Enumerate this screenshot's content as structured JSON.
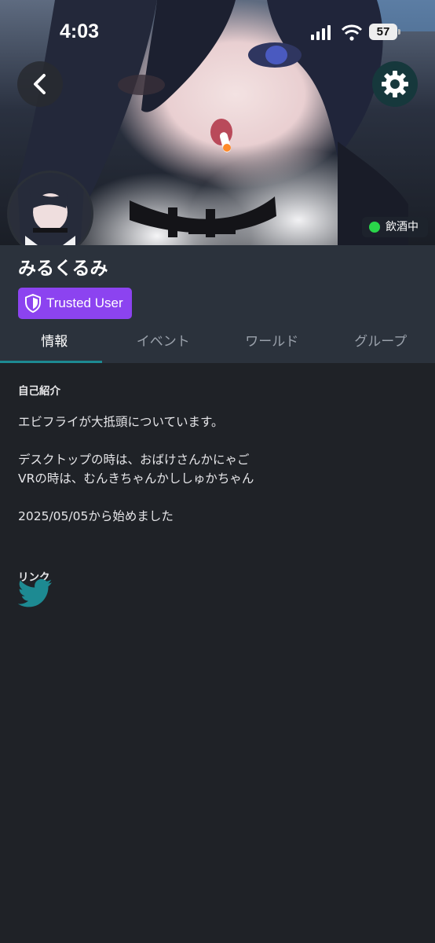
{
  "status_bar": {
    "time": "4:03",
    "battery": "57"
  },
  "header": {
    "back_icon": "chevron-left-icon",
    "settings_icon": "gear-icon",
    "status_text": "飲酒中",
    "status_color": "#2ad54a"
  },
  "profile": {
    "display_name": "みるくるみ",
    "trust_rank": "Trusted User",
    "trust_color": "#8c43f0"
  },
  "tabs": [
    {
      "label": "情報",
      "active": true
    },
    {
      "label": "イベント",
      "active": false
    },
    {
      "label": "ワールド",
      "active": false
    },
    {
      "label": "グループ",
      "active": false
    }
  ],
  "bio": {
    "title": "自己紹介",
    "lines": [
      "エビフライが大抵頭についています。",
      "",
      "デスクトップの時は、おばけさんかにゃご",
      "VRの時は、むんきちゃんかししゅかちゃん",
      "",
      "2025/05/05から始めました"
    ]
  },
  "links": {
    "title": "リンク",
    "items": [
      {
        "icon": "twitter-icon",
        "color": "#1d8a92"
      }
    ]
  },
  "colors": {
    "accent": "#1d8a92",
    "background": "#1f2227",
    "header_panel": "#2b323c"
  }
}
